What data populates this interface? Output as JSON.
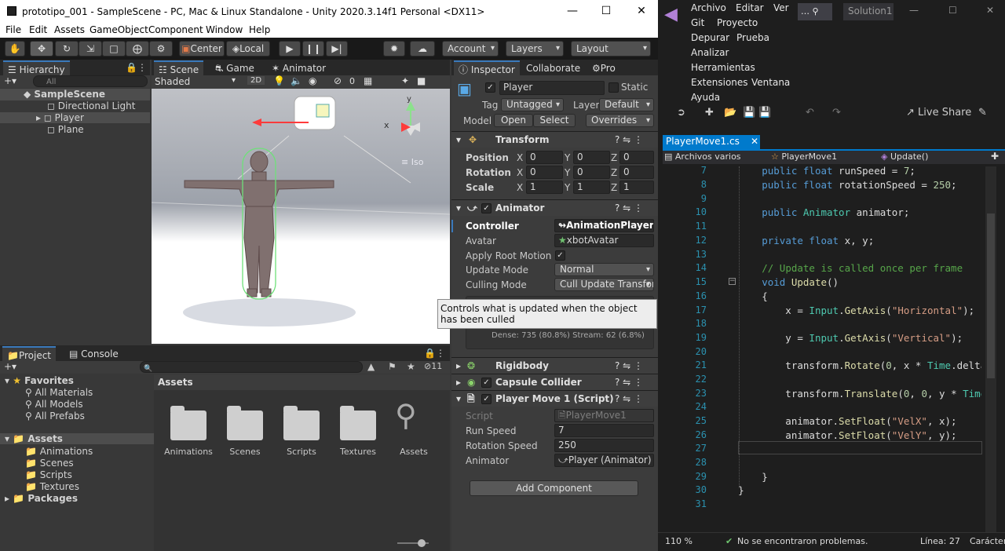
{
  "unity": {
    "title": "prototipo_001 - SampleScene - PC, Mac & Linux Standalone - Unity 2020.3.14f1 Personal <DX11>",
    "menu": [
      "File",
      "Edit",
      "Assets",
      "GameObject",
      "Component",
      "Window",
      "Help"
    ],
    "toolbar": {
      "center": "Center",
      "local": "Local",
      "account": "Account",
      "layers": "Layers",
      "layout": "Layout"
    },
    "hierarchy": {
      "tab": "Hierarchy",
      "search_placeholder": "All",
      "scene": "SampleScene",
      "items": [
        "Directional Light",
        "Player",
        "Plane"
      ]
    },
    "scene_tabs": [
      "Scene",
      "Game",
      "Animator"
    ],
    "scene_bar": {
      "shaded": "Shaded",
      "mode2d": "2D",
      "gizmo_count": "0",
      "persp": "≡ Iso"
    },
    "inspector": {
      "tabs": [
        "Inspector",
        "Collaborate",
        "Pro"
      ],
      "object_name": "Player",
      "static_label": "Static",
      "tag_label": "Tag",
      "tag": "Untagged",
      "layer_label": "Layer",
      "layer": "Default",
      "model_label": "Model",
      "open": "Open",
      "select": "Select",
      "overrides": "Overrides",
      "transform": {
        "title": "Transform",
        "rows": [
          {
            "label": "Position",
            "x": "0",
            "y": "0",
            "z": "0"
          },
          {
            "label": "Rotation",
            "x": "0",
            "y": "0",
            "z": "0"
          },
          {
            "label": "Scale",
            "x": "1",
            "y": "1",
            "z": "1"
          }
        ]
      },
      "animator": {
        "title": "Animator",
        "controller_label": "Controller",
        "controller": "AnimationPlayer",
        "avatar_label": "Avatar",
        "avatar": "xbotAvatar",
        "root_motion_label": "Apply Root Motion",
        "update_mode_label": "Update Mode",
        "update_mode": "Normal",
        "culling_label": "Culling Mode",
        "culling": "Cull Update Transfor",
        "clip_info": "Dense: 735 (80.8%) Stream: 62 (6.8%)"
      },
      "tooltip": "Controls what is updated when the object has been culled",
      "rigidbody": "Rigidbody",
      "capsule": "Capsule Collider",
      "script": {
        "title": "Player Move 1 (Script)",
        "script_label": "Script",
        "script": "PlayerMove1",
        "run_label": "Run Speed",
        "run": "7",
        "rot_label": "Rotation Speed",
        "rot": "250",
        "anim_label": "Animator",
        "anim": "Player (Animator)"
      },
      "add_component": "Add Component"
    },
    "project": {
      "tabs": [
        "Project",
        "Console"
      ],
      "hidden_count": "11",
      "favorites": "Favorites",
      "fav_items": [
        "All Materials",
        "All Models",
        "All Prefabs"
      ],
      "assets": "Assets",
      "asset_items": [
        "Animations",
        "Scenes",
        "Scripts",
        "Textures"
      ],
      "packages": "Packages",
      "breadcrumb": "Assets",
      "grid": [
        "Animations",
        "Scenes",
        "Scripts",
        "Textures",
        "Assets"
      ]
    }
  },
  "vs": {
    "menu": [
      "Archivo",
      "Editar",
      "Ver",
      "Git",
      "Proyecto",
      "Depurar",
      "Prueba",
      "Analizar",
      "Herramientas",
      "Extensiones",
      "Ventana",
      "Ayuda"
    ],
    "solution": "Solution1",
    "live_share": "Live Share",
    "tab": "PlayerMove1.cs",
    "nav": [
      "Archivos varios",
      "PlayerMove1",
      "Update()"
    ],
    "line_numbers": [
      "7",
      "8",
      "9",
      "10",
      "11",
      "12",
      "13",
      "14",
      "15",
      "16",
      "17",
      "18",
      "19",
      "20",
      "21",
      "22",
      "23",
      "24",
      "25",
      "26",
      "27",
      "28",
      "29",
      "30",
      "31"
    ],
    "status": {
      "zoom": "110 %",
      "issues": "No se encontraron problemas.",
      "line": "Línea: 27",
      "char": "Carácter:"
    }
  },
  "colors": {
    "unity_bg": "#383838",
    "vs_bg": "#1e1e1e",
    "accent": "#3a79bb",
    "vs_tab": "#007acc"
  }
}
